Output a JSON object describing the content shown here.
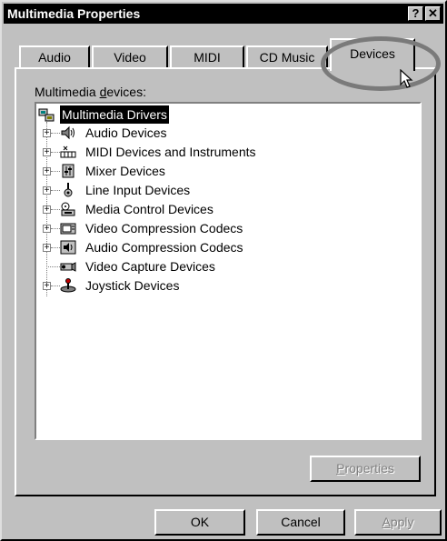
{
  "window": {
    "title": "Multimedia Properties",
    "help_label": "?",
    "close_label": "✕"
  },
  "tabs": [
    {
      "label": "Audio",
      "active": false
    },
    {
      "label": "Video",
      "active": false
    },
    {
      "label": "MIDI",
      "active": false
    },
    {
      "label": "CD Music",
      "active": false
    },
    {
      "label": "Devices",
      "active": true
    }
  ],
  "devices": {
    "label_pre": "Multimedia ",
    "label_mnemonic": "d",
    "label_post": "evices:",
    "root": {
      "label": "Multimedia Drivers",
      "icon": "multimedia-drivers-icon"
    },
    "items": [
      {
        "label": "Audio Devices",
        "icon": "audio-devices-icon",
        "expandable": true
      },
      {
        "label": "MIDI Devices and Instruments",
        "icon": "midi-icon",
        "expandable": true
      },
      {
        "label": "Mixer Devices",
        "icon": "mixer-icon",
        "expandable": true
      },
      {
        "label": "Line Input Devices",
        "icon": "line-input-icon",
        "expandable": true
      },
      {
        "label": "Media Control Devices",
        "icon": "media-control-icon",
        "expandable": true
      },
      {
        "label": "Video Compression Codecs",
        "icon": "video-codec-icon",
        "expandable": true
      },
      {
        "label": "Audio Compression Codecs",
        "icon": "audio-codec-icon",
        "expandable": true
      },
      {
        "label": "Video Capture Devices",
        "icon": "video-capture-icon",
        "expandable": false
      },
      {
        "label": "Joystick Devices",
        "icon": "joystick-icon",
        "expandable": true
      }
    ],
    "expand_symbol": "+"
  },
  "buttons": {
    "properties_mnemonic": "P",
    "properties_rest": "roperties",
    "ok": "OK",
    "cancel": "Cancel",
    "apply_mnemonic": "A",
    "apply_rest": "pply"
  }
}
